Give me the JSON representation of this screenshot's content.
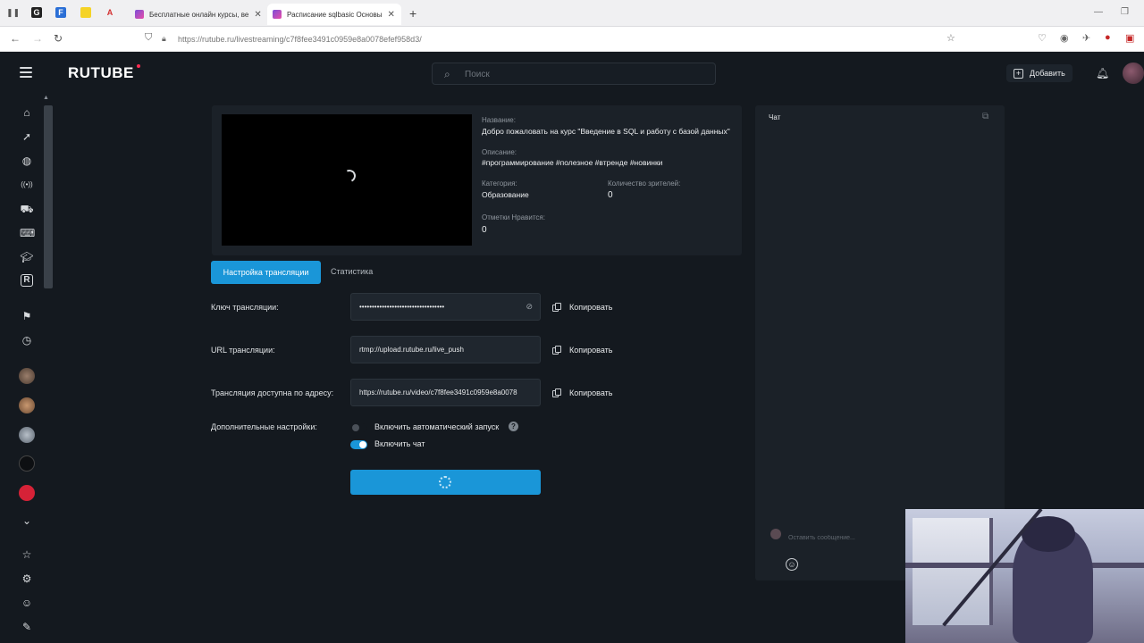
{
  "browser": {
    "tabs": [
      {
        "title": "Бесплатные онлайн курсы, ве",
        "active": false
      },
      {
        "title": "Расписание sqlbasic Основы",
        "active": true
      }
    ],
    "url": "https://rutube.ru/livestreaming/c7f8fee3491c0959e8a0078efef958d3/",
    "badge_count": "39"
  },
  "header": {
    "logo": "RUTUBE",
    "search_placeholder": "Поиск",
    "add_label": "Добавить"
  },
  "stream": {
    "name_label": "Название:",
    "name_value": "Добро пожаловать на курс \"Введение в SQL и работу с базой данных\"",
    "description_label": "Описание:",
    "description_value": "#программирование #полезное #втренде #новинки",
    "category_label": "Категория:",
    "category_value": "Образование",
    "viewers_label": "Количество зрителей:",
    "viewers_value": "0",
    "likes_label": "Отметки Нравится:",
    "likes_value": "0"
  },
  "tabs": {
    "settings": "Настройка трансляции",
    "stats": "Статистика"
  },
  "settings": {
    "key_label": "Ключ трансляции:",
    "key_value": "••••••••••••••••••••••••••••••••••",
    "url_label": "URL трансляции:",
    "url_value": "rtmp://upload.rutube.ru/live_push",
    "address_label": "Трансляция доступна по адресу:",
    "address_value": "https://rutube.ru/video/c7f8fee3491c0959e8a0078",
    "copy_label": "Копировать",
    "extra_label": "Дополнительные настройки:",
    "autostart_label": "Включить автоматический запуск",
    "autostart_on": false,
    "chat_label": "Включить чат",
    "chat_on": true
  },
  "chat": {
    "title": "Чат",
    "input_placeholder": "Оставить сообщение..."
  },
  "colors": {
    "accent": "#1a96d8",
    "background": "#14191f",
    "panel": "#1b2128"
  }
}
